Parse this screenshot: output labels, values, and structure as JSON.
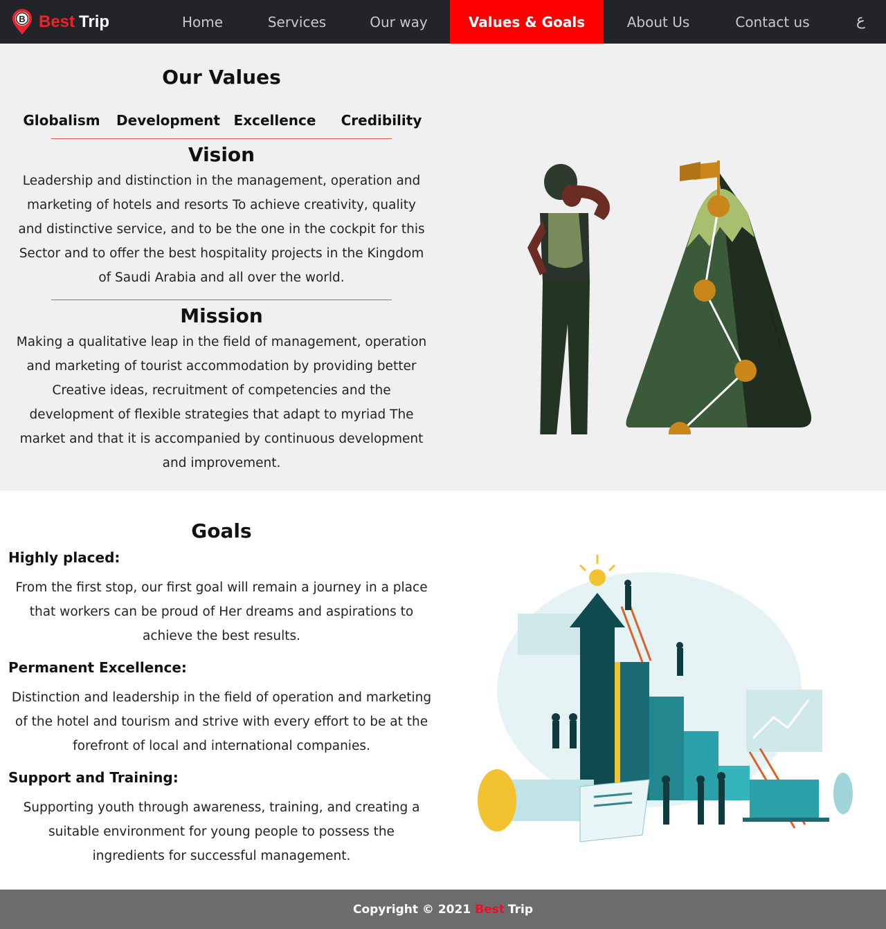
{
  "brand": {
    "badge_letter": "B",
    "best": "Best",
    "trip": "Trip",
    "accent_color": "#e8252b"
  },
  "nav": {
    "items": [
      {
        "label": "Home",
        "active": false
      },
      {
        "label": "Services",
        "active": false
      },
      {
        "label": "Our way",
        "active": false
      },
      {
        "label": "Values & Goals",
        "active": true
      },
      {
        "label": "About Us",
        "active": false
      },
      {
        "label": "Contact us",
        "active": false
      }
    ],
    "language_toggle": "ع",
    "active_color": "#ff0000"
  },
  "values": {
    "title": "Our Values",
    "items": [
      "Globalism",
      "Development",
      "Excellence",
      "Credibility"
    ],
    "vision_title": "Vision",
    "vision_text": "Leadership and distinction in the management, operation and marketing of hotels and resorts To achieve creativity, quality and distinctive service, and to be the one in the cockpit for this Sector and to offer the best hospitality projects in the Kingdom of Saudi Arabia and all over the world.",
    "mission_title": "Mission",
    "mission_text": "Making a qualitative leap in the field of management, operation and marketing of tourist accommodation by providing better Creative ideas, recruitment of competencies and the development of flexible strategies that adapt to myriad The market and that it is accompanied by continuous development and improvement."
  },
  "goals": {
    "title": "Goals",
    "items": [
      {
        "heading": "Highly placed:",
        "text": "From the first stop, our first goal will remain a journey in a place that workers can be proud of Her dreams and aspirations to achieve the best results."
      },
      {
        "heading": "Permanent Excellence:",
        "text": "Distinction and leadership in the field of operation and marketing of the hotel and tourism and strive with every effort to be at the forefront of local and international companies."
      },
      {
        "heading": "Support and Training:",
        "text": "Supporting youth through awareness, training, and creating a suitable environment for young people to possess the ingredients for successful management."
      }
    ]
  },
  "footer": {
    "prefix": "Copyright © 2021",
    "best": "Best",
    "trip": "Trip"
  }
}
